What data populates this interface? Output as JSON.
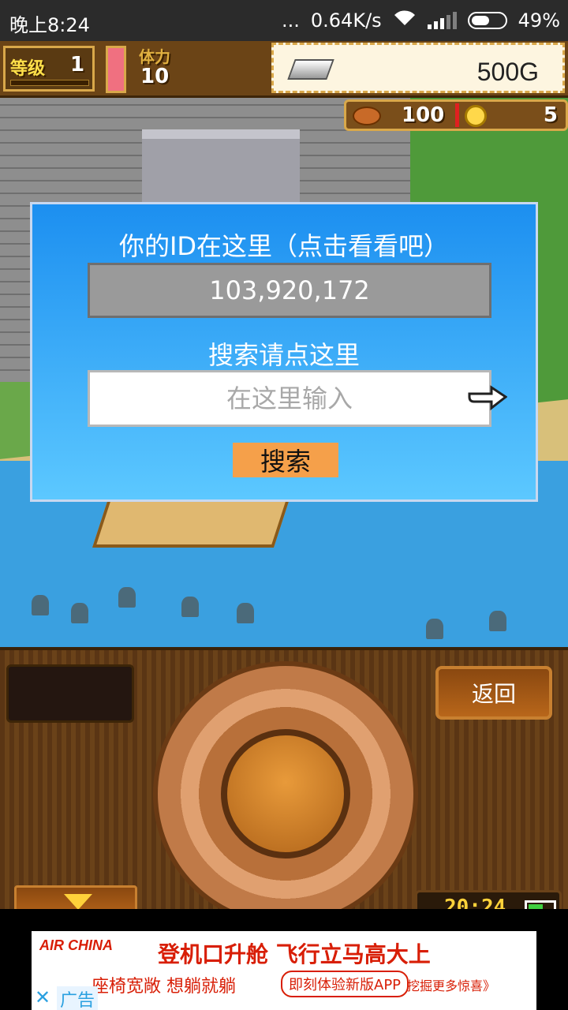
{
  "status_bar": {
    "time": "晚上8:24",
    "more": "...",
    "speed": "0.64K/s",
    "battery": "49%"
  },
  "hud": {
    "level_label": "等级",
    "level_value": "1",
    "stamina_label": "体力",
    "stamina_value": "10",
    "gold": "500G",
    "meat": "100",
    "coins": "5"
  },
  "dialog": {
    "title": "你的ID在这里（点击看看吧）",
    "player_id": "103,920,172",
    "search_hint": "搜索请点这里",
    "search_placeholder": "在这里输入",
    "search_button": "搜索"
  },
  "controller": {
    "back_button": "返回",
    "clock": "20:24"
  },
  "ad": {
    "brand": "AIR CHINA",
    "headline": "登机口升舱 飞行立马高大上",
    "line2": "座椅宽敞 想躺就躺",
    "cta": "即刻体验新版APP",
    "more": "挖掘更多惊喜》",
    "close": "✕",
    "label": "广告"
  },
  "colors": {
    "dialog_top": "#1c8ff0",
    "dialog_bottom": "#5cc8ff",
    "search_button": "#f5a04a",
    "ad_red": "#d81e06"
  }
}
